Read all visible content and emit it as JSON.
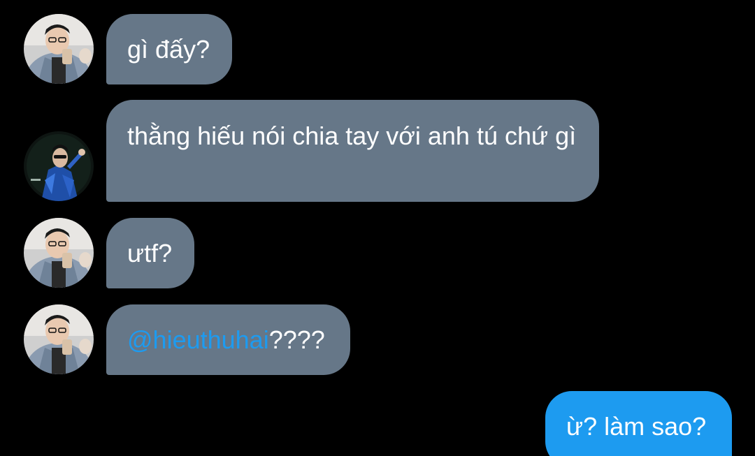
{
  "messages": [
    {
      "sender": "friend",
      "text": "gì đấy?"
    },
    {
      "sender": "other",
      "text": "thằng hiếu nói chia tay với anh tú chứ gì"
    },
    {
      "sender": "friend",
      "text": "ưtf?"
    },
    {
      "sender": "friend",
      "mention": "@hieuthuhai",
      "text": "????"
    },
    {
      "sender": "me",
      "text": "ừ? làm sao?"
    }
  ],
  "colors": {
    "background": "#000000",
    "incoming_bubble": "#667788",
    "outgoing_bubble": "#1d9bf0",
    "mention": "#1d9bf0",
    "text": "#ffffff"
  }
}
